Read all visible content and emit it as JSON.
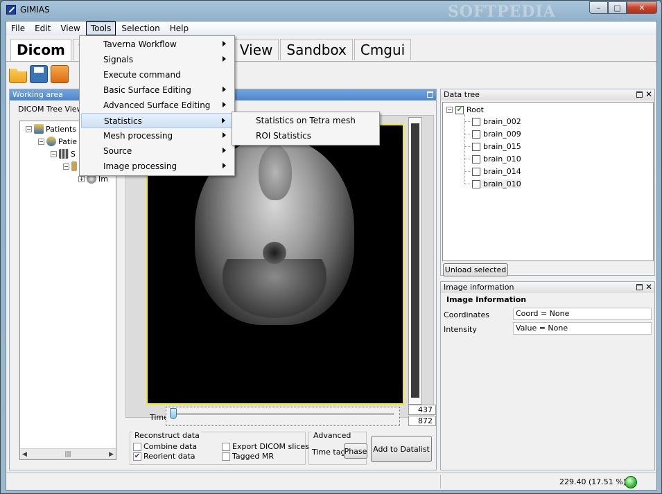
{
  "window": {
    "title": "GIMIAS",
    "watermark": "SOFTPEDIA"
  },
  "menubar": [
    "File",
    "Edit",
    "View",
    "Tools",
    "Selection",
    "Help"
  ],
  "tabs": [
    "Dicom",
    "T",
    "View",
    "Sandbox",
    "Cmgui"
  ],
  "working_area": {
    "title": "Working area",
    "dicom_label": "DICOM Tree Viewer",
    "tree": {
      "patients": "Patients",
      "patient": "Patie",
      "study": "S",
      "image": "Im"
    }
  },
  "viewer": {
    "time_label": "Time",
    "time_value": "437",
    "time_max": "872",
    "slider_fraction": 0.0
  },
  "reconstruct": {
    "title": "Reconstruct data",
    "combine": "Combine data",
    "reorient": "Reorient data",
    "export": "Export DICOM slices",
    "tagged": "Tagged MR"
  },
  "advanced": {
    "title": "Advanced",
    "time_tag": "Time tag",
    "phase": "Phase"
  },
  "add_to_datalist": "Add to Datalist",
  "data_tree": {
    "title": "Data tree",
    "root": "Root",
    "items": [
      "brain_002",
      "brain_009",
      "brain_015",
      "brain_010",
      "brain_014",
      "brain_010"
    ],
    "unload": "Unload selected"
  },
  "image_info": {
    "title": "Image information",
    "heading": "Image Information",
    "coordinates_label": "Coordinates",
    "coordinates_value": "Coord = None",
    "intensity_label": "Intensity",
    "intensity_value": "Value = None"
  },
  "status": {
    "text": "229.40  (17.51 %)"
  },
  "tools_menu": [
    "Taverna Workflow",
    "Signals",
    "Execute command",
    "Basic Surface Editing",
    "Advanced Surface Editing",
    "Statistics",
    "Mesh processing",
    "Source",
    "Image processing"
  ],
  "statistics_submenu": [
    "Statistics on Tetra mesh",
    "ROI Statistics"
  ],
  "icons": {
    "open": "folder-open-icon",
    "save": "save-icon",
    "open_multi": "folders-icon"
  }
}
